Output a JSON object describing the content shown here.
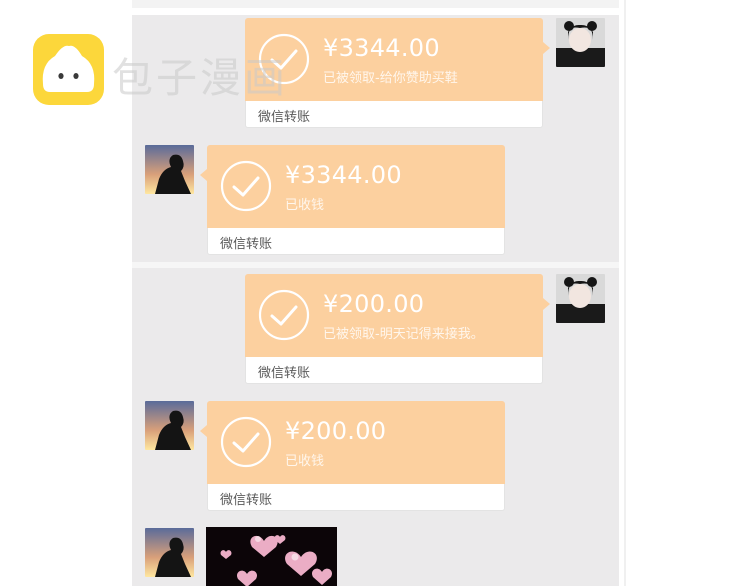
{
  "watermark": {
    "text": "包子漫画"
  },
  "colors": {
    "transfer_bg": "#fcd09f",
    "chat_bg": "#ebeaeb",
    "logo_yellow": "#fcd73b"
  },
  "messages": [
    {
      "sender": "her",
      "side": "right",
      "amount": "¥3344.00",
      "status": "已被领取-给你赞助买鞋",
      "footer": "微信转账",
      "icon": "check-circle-icon"
    },
    {
      "sender": "him",
      "side": "left",
      "amount": "¥3344.00",
      "status": "已收钱",
      "footer": "微信转账",
      "icon": "check-circle-icon"
    },
    {
      "sender": "her",
      "side": "right",
      "amount": "¥200.00",
      "status": "已被领取-明天记得来接我。",
      "footer": "微信转账",
      "icon": "check-circle-icon"
    },
    {
      "sender": "him",
      "side": "left",
      "amount": "¥200.00",
      "status": "已收钱",
      "footer": "微信转账",
      "icon": "check-circle-icon"
    },
    {
      "sender": "him",
      "side": "left",
      "type": "image",
      "image": "pink-hearts-photo"
    }
  ]
}
